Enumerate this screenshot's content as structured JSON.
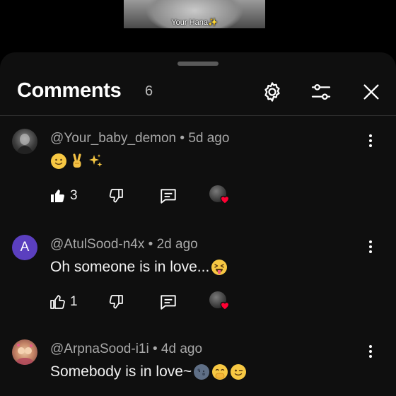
{
  "video": {
    "caption": "Your Hana✨"
  },
  "header": {
    "title": "Comments",
    "count": "6"
  },
  "icons": {
    "settings": "gear-icon",
    "filter": "sliders-icon",
    "close": "close-icon",
    "like": "thumb-up-icon",
    "dislike": "thumb-down-icon",
    "reply": "reply-icon",
    "more": "kebab-menu-icon",
    "creator_heart": "heart-icon"
  },
  "colors": {
    "background": "#0f0f0f",
    "accent_heart": "#ff0033",
    "avatar_a": "#5b3fbf"
  },
  "comments": [
    {
      "author": "@Your_baby_demon",
      "time": "5d ago",
      "text": "",
      "emojis": [
        "slightly-smiling-face",
        "victory-hand",
        "sparkles"
      ],
      "likes": "3",
      "liked": true,
      "hearted": true
    },
    {
      "author": "@AtulSood-n4x",
      "avatar_letter": "A",
      "time": "2d ago",
      "text": "Oh someone is in love...",
      "emojis": [
        "squinting-face-with-tongue"
      ],
      "likes": "1",
      "liked": false,
      "hearted": true
    },
    {
      "author": "@ArpnaSood-i1i",
      "time": "4d ago",
      "text": "Somebody is in love~",
      "emojis": [
        "new-moon-face",
        "face-with-hand-over-mouth",
        "winking-face"
      ]
    }
  ]
}
